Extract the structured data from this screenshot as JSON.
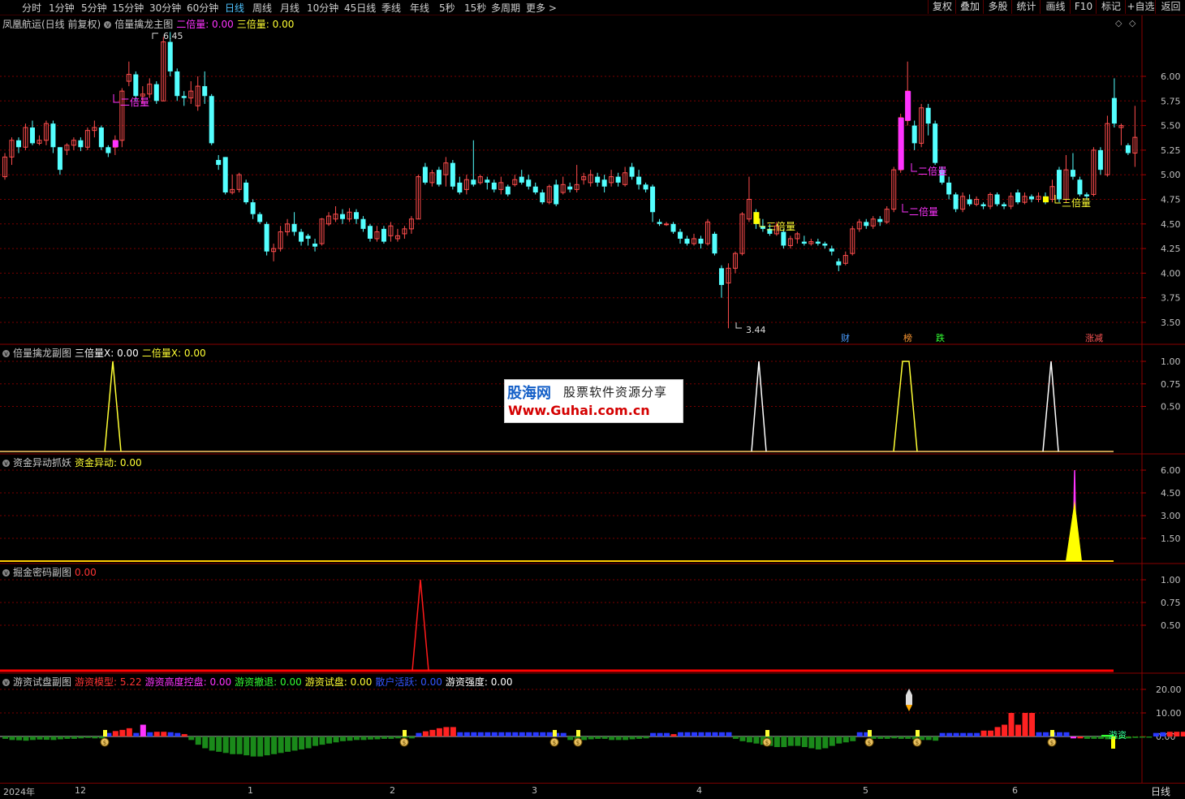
{
  "toolbar": {
    "timeframes": [
      "分时",
      "1分钟",
      "5分钟",
      "15分钟",
      "30分钟",
      "60分钟",
      "日线",
      "周线",
      "月线",
      "10分钟",
      "45日线",
      "季线",
      "年线",
      "5秒",
      "15秒",
      "多周期",
      "更多 >"
    ],
    "active_timeframe": "日线",
    "right_buttons": [
      "复权",
      "叠加",
      "多股",
      "统计",
      "画线",
      "F10",
      "标记",
      "+自选",
      "返回"
    ]
  },
  "main_panel": {
    "stock": "凤凰航运(日线 前复权)",
    "indicator": "倍量擒龙主图",
    "fields": [
      {
        "label": "二倍量: 0.00",
        "color": "#ff33ff"
      },
      {
        "label": "三倍量: 0.00",
        "color": "#ffff33"
      }
    ],
    "high_label": "6.45",
    "low_label": "3.44",
    "y_ticks": [
      "6.00",
      "5.75",
      "5.50",
      "5.25",
      "5.00",
      "4.75",
      "4.50",
      "4.25",
      "4.00",
      "3.75",
      "3.50"
    ],
    "annotations": [
      "二倍量",
      "三倍量",
      "二倍量",
      "二倍量",
      "三倍量"
    ],
    "markers": [
      {
        "text": "财",
        "color": "#4a9cff"
      },
      {
        "text": "榜",
        "color": "#ff9933"
      },
      {
        "text": "跌",
        "color": "#33ff33"
      },
      {
        "text": "涨减",
        "color": "#ff5555"
      }
    ]
  },
  "sub1": {
    "indicator": "倍量擒龙副图",
    "fields": [
      {
        "label": "三倍量X: 0.00",
        "color": "#ffffff"
      },
      {
        "label": "二倍量X: 0.00",
        "color": "#ffff33"
      }
    ],
    "y_ticks": [
      "1.00",
      "0.75",
      "0.50"
    ]
  },
  "sub2": {
    "indicator": "资金异动抓妖",
    "fields": [
      {
        "label": "资金异动: 0.00",
        "color": "#ffff33"
      }
    ],
    "y_ticks": [
      "6.00",
      "4.50",
      "3.00",
      "1.50"
    ]
  },
  "sub3": {
    "indicator": "掘金密码副图",
    "fields": [
      {
        "label": "0.00",
        "color": "#ff3333"
      }
    ],
    "y_ticks": [
      "1.00",
      "0.75",
      "0.50"
    ]
  },
  "sub4": {
    "indicator": "游资试盘副图",
    "fields": [
      {
        "label": "游资模型: 5.22",
        "color": "#ff3333"
      },
      {
        "label": "游资高度控盘: 0.00",
        "color": "#ff33ff"
      },
      {
        "label": "游资撤退: 0.00",
        "color": "#33ff33"
      },
      {
        "label": "游资试盘: 0.00",
        "color": "#ffff33"
      },
      {
        "label": "散户活跃: 0.00",
        "color": "#3355ff"
      },
      {
        "label": "游资强度: 0.00",
        "color": "#ffffff"
      }
    ],
    "y_ticks": [
      "20.00",
      "10.00",
      "0.00"
    ],
    "tag": "游资"
  },
  "date_axis": [
    "2024年",
    "12",
    "1",
    "2",
    "3",
    "4",
    "5",
    "6"
  ],
  "period_label": "日线",
  "watermark": {
    "brand": "股海网",
    "slogan": "股票软件资源分享",
    "url": "Www.Guhai.com.cn"
  },
  "colors": {
    "up": "#ff4d4d",
    "down": "#54ffff",
    "grid": "#7a0000",
    "axis_text": "#c0c0c0"
  }
}
